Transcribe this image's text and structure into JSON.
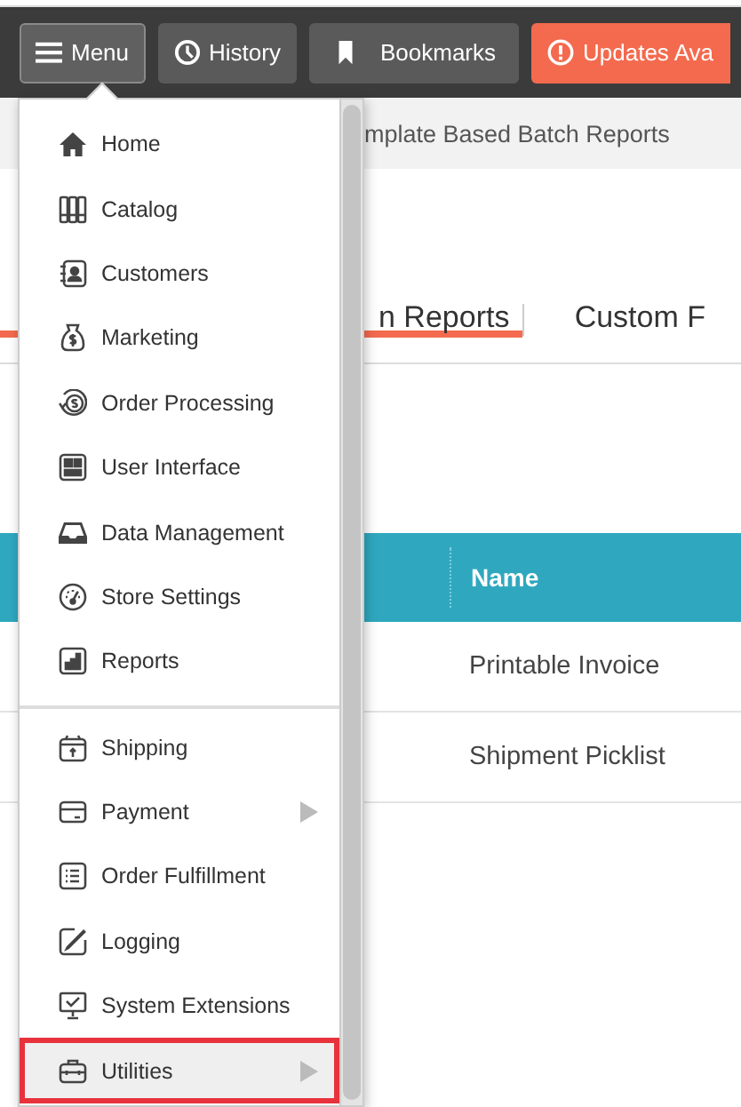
{
  "toolbar": {
    "buttons": [
      {
        "label": "Menu",
        "kind": "menu",
        "selected": true
      },
      {
        "label": "History",
        "kind": "history",
        "selected": false
      },
      {
        "label": "Bookmarks",
        "kind": "bookmark",
        "selected": false
      },
      {
        "label": "Updates Ava",
        "kind": "alert",
        "selected": false
      }
    ]
  },
  "breadcrumb": "mplate Based Batch Reports",
  "tabs": [
    {
      "label": "n Reports",
      "selected": true
    },
    {
      "label": "Custom F",
      "selected": false
    }
  ],
  "table": {
    "columns": [
      "Name"
    ],
    "rows": [
      [
        "Printable Invoice"
      ],
      [
        "Shipment Picklist"
      ]
    ]
  },
  "menu": {
    "groups": [
      [
        {
          "label": "Home",
          "kind": "home",
          "submenu": false,
          "highlighted": false
        },
        {
          "label": "Catalog",
          "kind": "catalog",
          "submenu": false,
          "highlighted": false
        },
        {
          "label": "Customers",
          "kind": "contacts",
          "submenu": false,
          "highlighted": false
        },
        {
          "label": "Marketing",
          "kind": "moneybag",
          "submenu": false,
          "highlighted": false
        },
        {
          "label": "Order Processing",
          "kind": "coin",
          "submenu": false,
          "highlighted": false
        },
        {
          "label": "User Interface",
          "kind": "layout",
          "submenu": false,
          "highlighted": false
        },
        {
          "label": "Data Management",
          "kind": "tray",
          "submenu": false,
          "highlighted": false
        },
        {
          "label": "Store Settings",
          "kind": "gauge",
          "submenu": false,
          "highlighted": false
        },
        {
          "label": "Reports",
          "kind": "chart",
          "submenu": false,
          "highlighted": false
        }
      ],
      [
        {
          "label": "Shipping",
          "kind": "package",
          "submenu": false,
          "highlighted": false
        },
        {
          "label": "Payment",
          "kind": "card",
          "submenu": true,
          "highlighted": false
        },
        {
          "label": "Order Fulfillment",
          "kind": "list",
          "submenu": false,
          "highlighted": false
        },
        {
          "label": "Logging",
          "kind": "pencil",
          "submenu": false,
          "highlighted": false
        },
        {
          "label": "System Extensions",
          "kind": "monitor",
          "submenu": false,
          "highlighted": false
        },
        {
          "label": "Utilities",
          "kind": "toolbox",
          "submenu": true,
          "highlighted": true
        }
      ]
    ]
  }
}
